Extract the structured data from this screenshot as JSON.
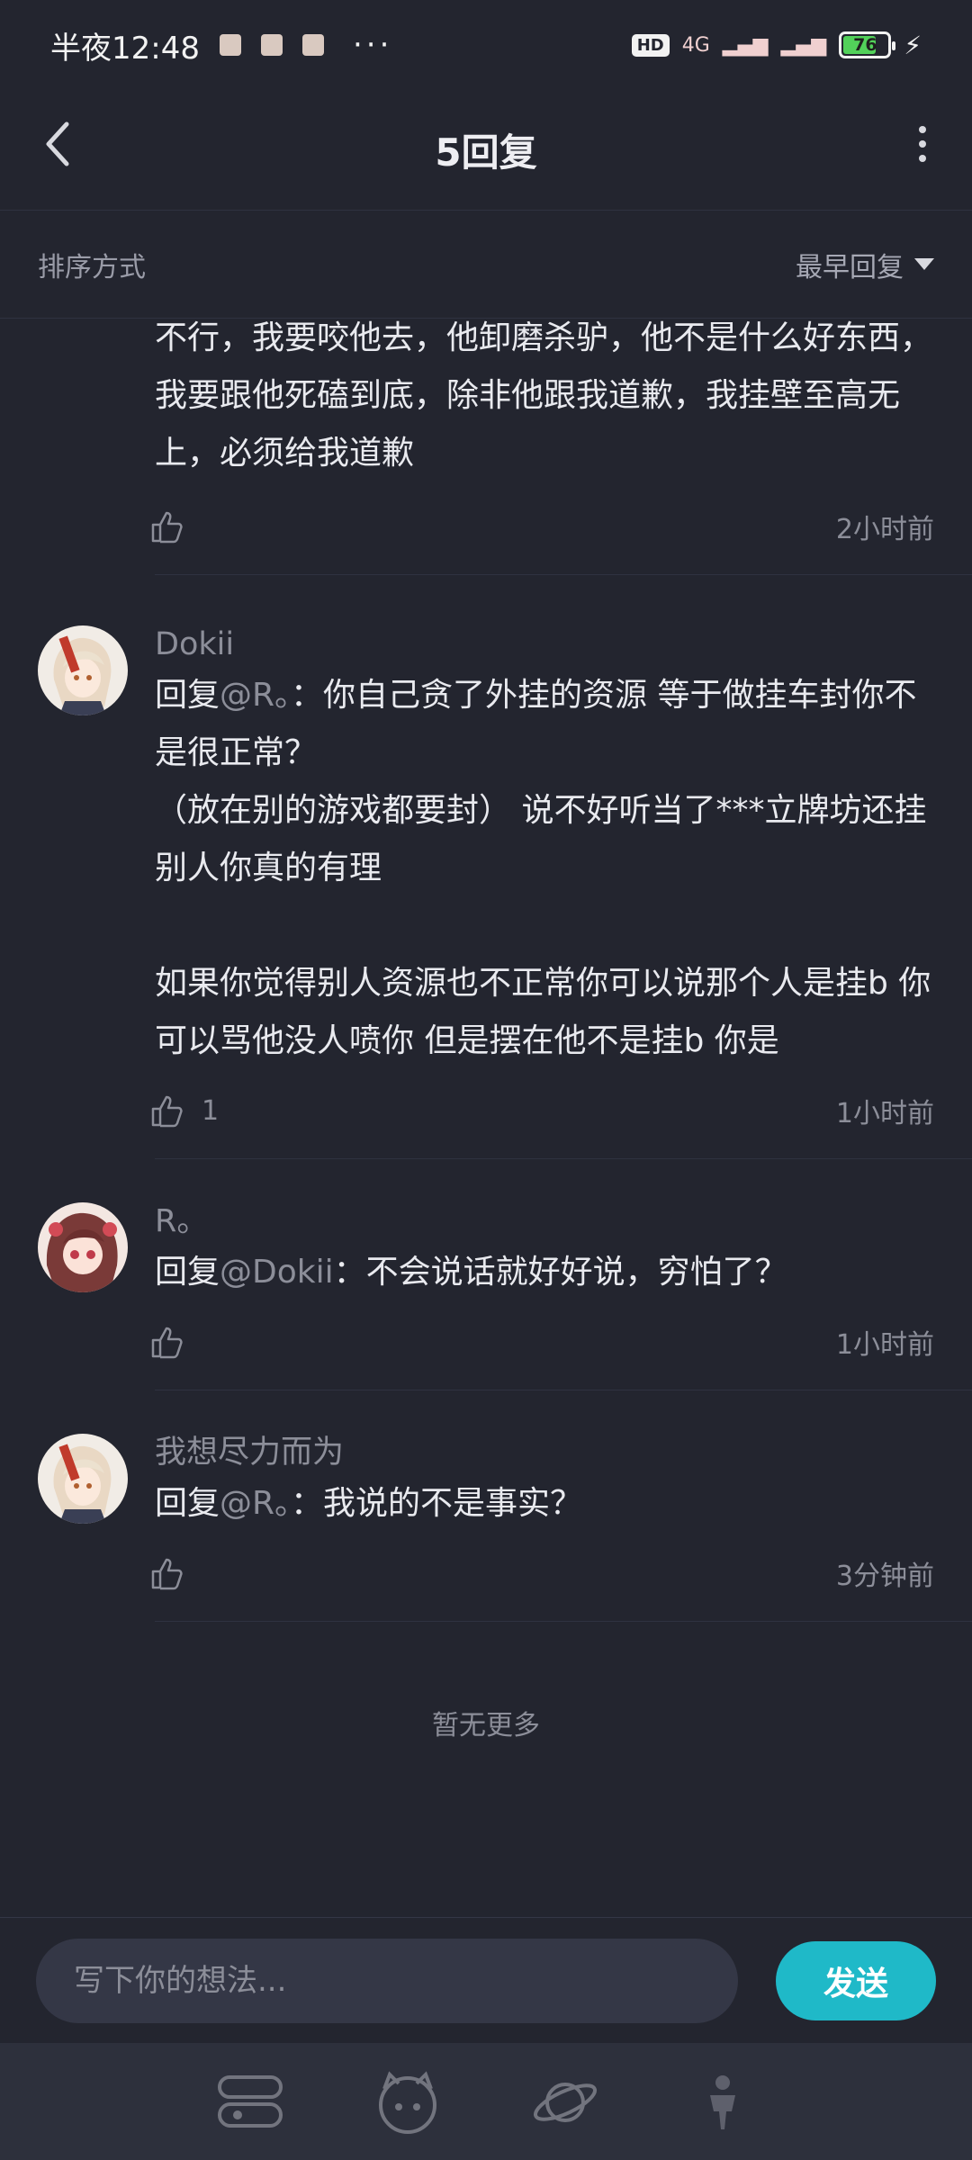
{
  "status_bar": {
    "time": "半夜12:48",
    "more": "···",
    "hd": "HD",
    "network": "4G",
    "battery": "76",
    "battery_fraction": 0.76
  },
  "header": {
    "title": "5回复",
    "back_icon": "chevron-left-icon",
    "more_icon": "more-vertical-icon"
  },
  "sort": {
    "label": "排序方式",
    "selected": "最早回复"
  },
  "comments": [
    {
      "user": "",
      "reply_prefix": "",
      "mention": "",
      "text": "不行，我要咬他去，他卸磨杀驴，他不是什么好东西，我要跟他死磕到底，除非他跟我道歉，我挂壁至高无上，必须给我道歉",
      "likes": "",
      "time": "2小时前"
    },
    {
      "user": "Dokii",
      "reply_prefix": "回复",
      "mention": "@R。",
      "text": "：你自己贪了外挂的资源 等于做挂车封你不是很正常？\n（放在别的游戏都要封） 说不好听当了***立牌坊还挂别人你真的有理\n\n如果你觉得别人资源也不正常你可以说那个人是挂b 你可以骂他没人喷你 但是摆在他不是挂b 你是",
      "likes": "1",
      "time": "1小时前"
    },
    {
      "user": "R。",
      "reply_prefix": "回复",
      "mention": "@Dokii",
      "text": "：不会说话就好好说，穷怕了？",
      "likes": "",
      "time": "1小时前"
    },
    {
      "user": "我想尽力而为",
      "reply_prefix": "回复",
      "mention": "@R。",
      "text": "：我说的不是事实？",
      "likes": "",
      "time": "3分钟前"
    }
  ],
  "footer_note": "暂无更多",
  "composer": {
    "placeholder": "写下你的想法...",
    "send_label": "发送"
  },
  "colors": {
    "background": "#23252f",
    "accent": "#1fb9c8",
    "muted_text": "#8c8e99"
  }
}
